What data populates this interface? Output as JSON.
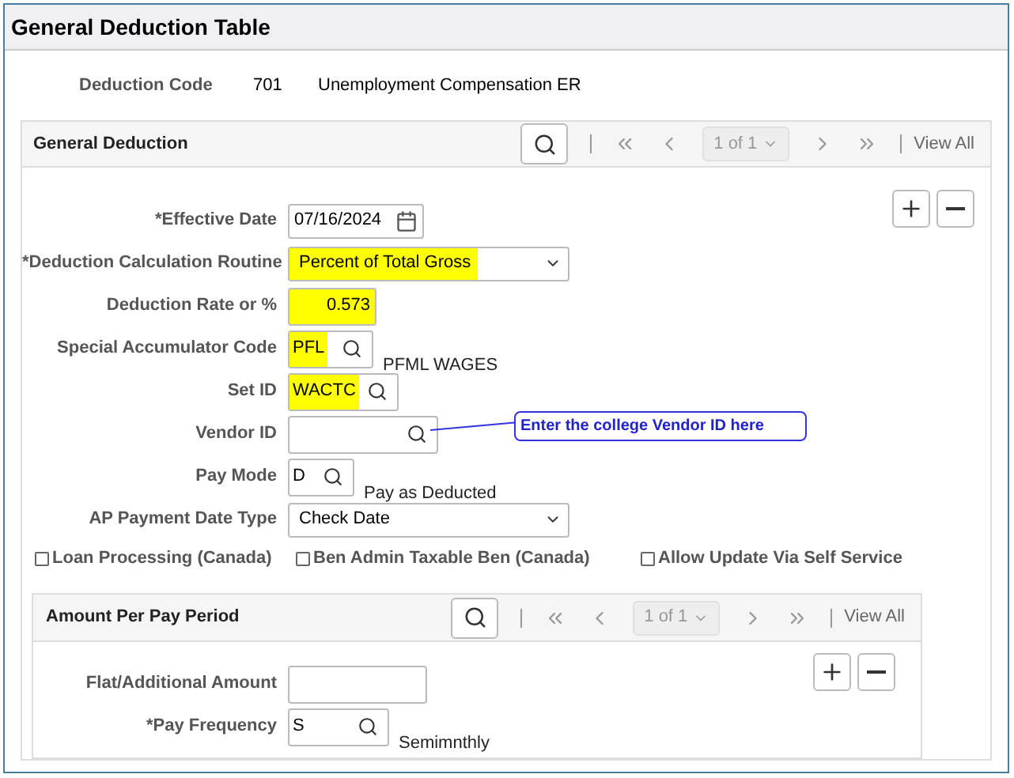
{
  "title": "General Deduction Table",
  "deduction_code": {
    "label": "Deduction Code",
    "code": "701",
    "description": "Unemployment Compensation ER"
  },
  "general_deduction": {
    "title": "General Deduction",
    "pager": {
      "page": "1 of 1",
      "view_all": "View All"
    },
    "fields": [
      {
        "kind": "date",
        "label": "*Effective Date",
        "value": "07/16/2024"
      },
      {
        "kind": "select",
        "label": "*Deduction Calculation Routine",
        "value": "Percent of Total Gross",
        "highlighted": true
      },
      {
        "kind": "number",
        "label": "Deduction Rate or %",
        "value": "0.573",
        "highlighted": true
      },
      {
        "kind": "lookup",
        "label": "Special Accumulator Code",
        "value": "PFL",
        "highlighted": true,
        "description": "PFML WAGES"
      },
      {
        "kind": "lookup",
        "label": "Set ID",
        "value": "WACTC",
        "highlighted": true
      },
      {
        "kind": "lookup",
        "label": "Vendor ID",
        "callout": "Enter the college Vendor ID here"
      },
      {
        "kind": "lookup",
        "label": "Pay Mode",
        "value": "D",
        "description": "Pay as Deducted"
      },
      {
        "kind": "select",
        "label": "AP Payment Date Type",
        "value": "Check Date"
      }
    ],
    "checkboxes": [
      {
        "label": "Loan Processing (Canada)",
        "checked": false
      },
      {
        "label": "Ben Admin Taxable Ben (Canada)",
        "checked": false
      },
      {
        "label": "Allow Update Via Self Service",
        "checked": false
      }
    ]
  },
  "amount_per_pay_period": {
    "title": "Amount Per Pay Period",
    "pager": {
      "page": "1 of 1",
      "view_all": "View All"
    },
    "fields": [
      {
        "kind": "text",
        "label": "Flat/Additional Amount"
      },
      {
        "kind": "lookup",
        "label": "*Pay Frequency",
        "value": "S",
        "description": "Semimnthly"
      }
    ]
  }
}
